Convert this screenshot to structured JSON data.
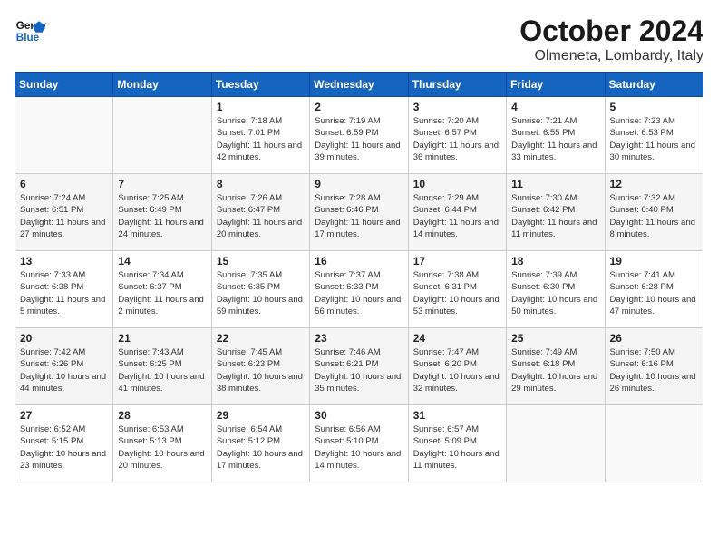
{
  "header": {
    "logo_line1": "General",
    "logo_line2": "Blue",
    "month": "October 2024",
    "location": "Olmeneta, Lombardy, Italy"
  },
  "weekdays": [
    "Sunday",
    "Monday",
    "Tuesday",
    "Wednesday",
    "Thursday",
    "Friday",
    "Saturday"
  ],
  "weeks": [
    [
      {
        "day": "",
        "info": ""
      },
      {
        "day": "",
        "info": ""
      },
      {
        "day": "1",
        "info": "Sunrise: 7:18 AM\nSunset: 7:01 PM\nDaylight: 11 hours and 42 minutes."
      },
      {
        "day": "2",
        "info": "Sunrise: 7:19 AM\nSunset: 6:59 PM\nDaylight: 11 hours and 39 minutes."
      },
      {
        "day": "3",
        "info": "Sunrise: 7:20 AM\nSunset: 6:57 PM\nDaylight: 11 hours and 36 minutes."
      },
      {
        "day": "4",
        "info": "Sunrise: 7:21 AM\nSunset: 6:55 PM\nDaylight: 11 hours and 33 minutes."
      },
      {
        "day": "5",
        "info": "Sunrise: 7:23 AM\nSunset: 6:53 PM\nDaylight: 11 hours and 30 minutes."
      }
    ],
    [
      {
        "day": "6",
        "info": "Sunrise: 7:24 AM\nSunset: 6:51 PM\nDaylight: 11 hours and 27 minutes."
      },
      {
        "day": "7",
        "info": "Sunrise: 7:25 AM\nSunset: 6:49 PM\nDaylight: 11 hours and 24 minutes."
      },
      {
        "day": "8",
        "info": "Sunrise: 7:26 AM\nSunset: 6:47 PM\nDaylight: 11 hours and 20 minutes."
      },
      {
        "day": "9",
        "info": "Sunrise: 7:28 AM\nSunset: 6:46 PM\nDaylight: 11 hours and 17 minutes."
      },
      {
        "day": "10",
        "info": "Sunrise: 7:29 AM\nSunset: 6:44 PM\nDaylight: 11 hours and 14 minutes."
      },
      {
        "day": "11",
        "info": "Sunrise: 7:30 AM\nSunset: 6:42 PM\nDaylight: 11 hours and 11 minutes."
      },
      {
        "day": "12",
        "info": "Sunrise: 7:32 AM\nSunset: 6:40 PM\nDaylight: 11 hours and 8 minutes."
      }
    ],
    [
      {
        "day": "13",
        "info": "Sunrise: 7:33 AM\nSunset: 6:38 PM\nDaylight: 11 hours and 5 minutes."
      },
      {
        "day": "14",
        "info": "Sunrise: 7:34 AM\nSunset: 6:37 PM\nDaylight: 11 hours and 2 minutes."
      },
      {
        "day": "15",
        "info": "Sunrise: 7:35 AM\nSunset: 6:35 PM\nDaylight: 10 hours and 59 minutes."
      },
      {
        "day": "16",
        "info": "Sunrise: 7:37 AM\nSunset: 6:33 PM\nDaylight: 10 hours and 56 minutes."
      },
      {
        "day": "17",
        "info": "Sunrise: 7:38 AM\nSunset: 6:31 PM\nDaylight: 10 hours and 53 minutes."
      },
      {
        "day": "18",
        "info": "Sunrise: 7:39 AM\nSunset: 6:30 PM\nDaylight: 10 hours and 50 minutes."
      },
      {
        "day": "19",
        "info": "Sunrise: 7:41 AM\nSunset: 6:28 PM\nDaylight: 10 hours and 47 minutes."
      }
    ],
    [
      {
        "day": "20",
        "info": "Sunrise: 7:42 AM\nSunset: 6:26 PM\nDaylight: 10 hours and 44 minutes."
      },
      {
        "day": "21",
        "info": "Sunrise: 7:43 AM\nSunset: 6:25 PM\nDaylight: 10 hours and 41 minutes."
      },
      {
        "day": "22",
        "info": "Sunrise: 7:45 AM\nSunset: 6:23 PM\nDaylight: 10 hours and 38 minutes."
      },
      {
        "day": "23",
        "info": "Sunrise: 7:46 AM\nSunset: 6:21 PM\nDaylight: 10 hours and 35 minutes."
      },
      {
        "day": "24",
        "info": "Sunrise: 7:47 AM\nSunset: 6:20 PM\nDaylight: 10 hours and 32 minutes."
      },
      {
        "day": "25",
        "info": "Sunrise: 7:49 AM\nSunset: 6:18 PM\nDaylight: 10 hours and 29 minutes."
      },
      {
        "day": "26",
        "info": "Sunrise: 7:50 AM\nSunset: 6:16 PM\nDaylight: 10 hours and 26 minutes."
      }
    ],
    [
      {
        "day": "27",
        "info": "Sunrise: 6:52 AM\nSunset: 5:15 PM\nDaylight: 10 hours and 23 minutes."
      },
      {
        "day": "28",
        "info": "Sunrise: 6:53 AM\nSunset: 5:13 PM\nDaylight: 10 hours and 20 minutes."
      },
      {
        "day": "29",
        "info": "Sunrise: 6:54 AM\nSunset: 5:12 PM\nDaylight: 10 hours and 17 minutes."
      },
      {
        "day": "30",
        "info": "Sunrise: 6:56 AM\nSunset: 5:10 PM\nDaylight: 10 hours and 14 minutes."
      },
      {
        "day": "31",
        "info": "Sunrise: 6:57 AM\nSunset: 5:09 PM\nDaylight: 10 hours and 11 minutes."
      },
      {
        "day": "",
        "info": ""
      },
      {
        "day": "",
        "info": ""
      }
    ]
  ]
}
